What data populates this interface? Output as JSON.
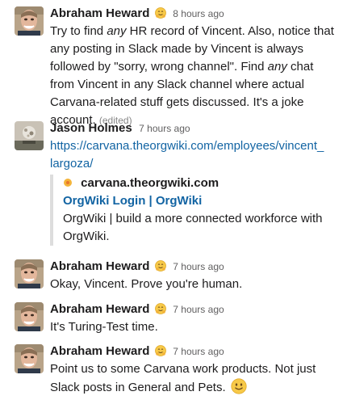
{
  "messages": [
    {
      "author": "Abraham Heward",
      "status_icon": "hugging-face-emoji",
      "time": "8 hours ago",
      "text_parts": [
        "Try to find ",
        "any",
        " HR record of Vincent. Also, notice that any posting in Slack made by Vincent is always followed by \"sorry, wrong channel\". Find ",
        "any",
        " chat from Vincent in any Slack channel where actual Carvana-related stuff gets discussed. It's a joke account."
      ],
      "edited_label": "(edited)"
    },
    {
      "author": "Jason Holmes",
      "time": "7 hours ago",
      "link": "https://carvana.theorgwiki.com/employees/vincent_largoza/",
      "unfurl": {
        "site_name": "carvana.theorgwiki.com",
        "title": "OrgWiki Login | OrgWiki",
        "description": "OrgWiki | build a more connected workforce with OrgWiki."
      }
    },
    {
      "author": "Abraham Heward",
      "status_icon": "hugging-face-emoji",
      "time": "7 hours ago",
      "text": "Okay, Vincent. Prove you're human."
    },
    {
      "author": "Abraham Heward",
      "status_icon": "hugging-face-emoji",
      "time": "7 hours ago",
      "text": "It's Turing-Test time."
    },
    {
      "author": "Abraham Heward",
      "status_icon": "hugging-face-emoji",
      "time": "7 hours ago",
      "text": "Point us to some Carvana work products. Not just Slack posts in General and Pets.",
      "trailing_emoji": "slightly-smiling-face-emoji"
    }
  ],
  "colors": {
    "link": "#1264a3",
    "text": "#1d1c1d",
    "timestamp": "#616061",
    "unfurl_border": "#dddddd",
    "emoji_yellow": "#f7c948"
  }
}
